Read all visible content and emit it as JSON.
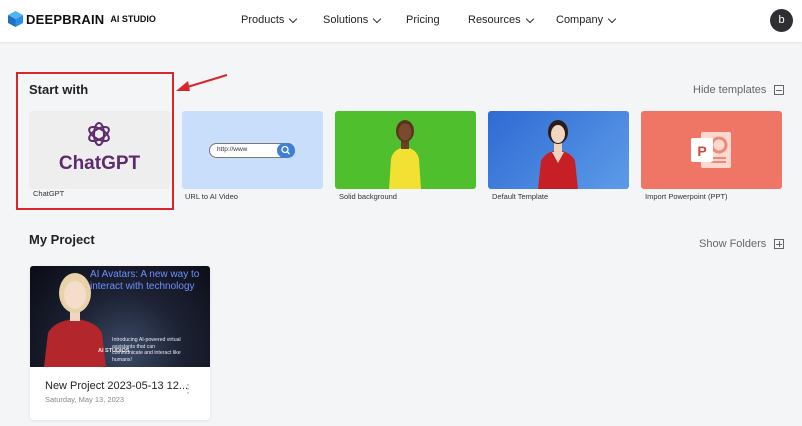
{
  "header": {
    "brand": "DEEPBRAIN",
    "brand_sub": "AI STUDIO",
    "nav": [
      {
        "label": "Products",
        "has_dropdown": true
      },
      {
        "label": "Solutions",
        "has_dropdown": true
      },
      {
        "label": "Pricing",
        "has_dropdown": false
      },
      {
        "label": "Resources",
        "has_dropdown": true
      },
      {
        "label": "Company",
        "has_dropdown": true
      }
    ],
    "avatar_initial": "b"
  },
  "start_with": {
    "title": "Start with",
    "hide_templates": "Hide templates",
    "templates": [
      {
        "label": "ChatGPT",
        "thumb_text": "ChatGPT",
        "thumb_bg": "#eeeeee",
        "icon": "openai-logo-icon"
      },
      {
        "label": "URL to AI Video",
        "thumb_text": "http://www",
        "thumb_bg": "#c9defa",
        "icon": "search-icon"
      },
      {
        "label": "Solid background",
        "thumb_bg": "#4fbf2d"
      },
      {
        "label": "Default Template",
        "thumb_bg": "#3d77d6"
      },
      {
        "label": "Import Powerpoint (PPT)",
        "thumb_bg": "#ef7565",
        "icon": "powerpoint-icon"
      }
    ]
  },
  "my_project": {
    "title": "My Project",
    "show_folders": "Show Folders",
    "projects": [
      {
        "name": "New Project 2023-05-13 12...",
        "date": "Saturday, May 13, 2023",
        "thumb_title": "AI Avatars: A new way to interact with technology",
        "thumb_caption": "Introducing AI-powered virtual assistants that can communicate and interact like humans!",
        "thumb_watermark": "AI STUDIOS"
      }
    ]
  },
  "colors": {
    "highlight": "#d8262c",
    "chatgpt_purple": "#5e2b6e",
    "brand_blue": "#1f8ad9"
  }
}
